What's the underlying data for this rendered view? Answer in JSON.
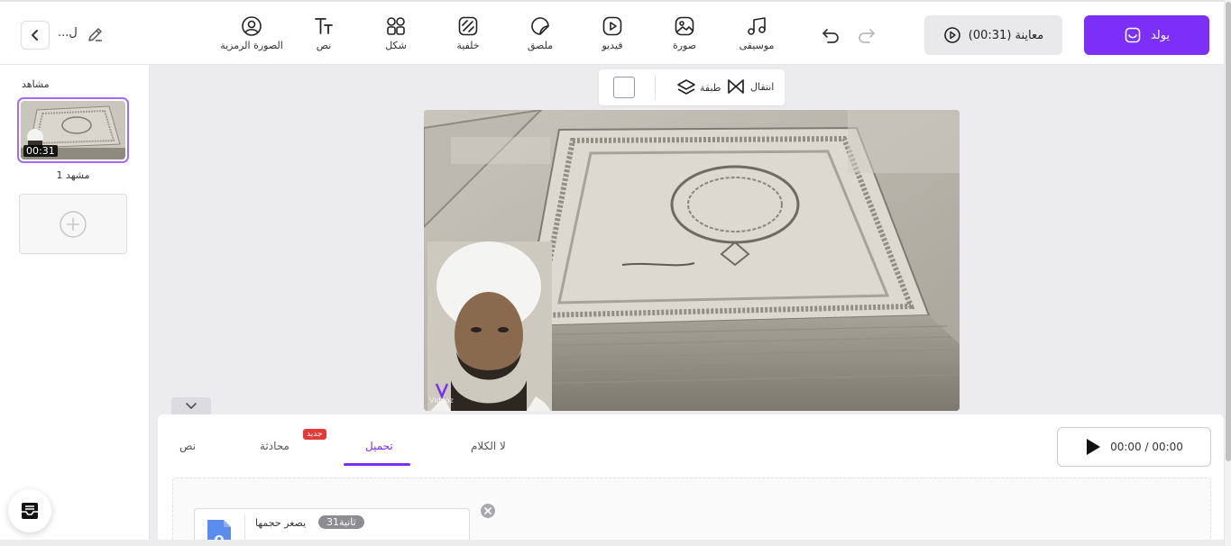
{
  "header": {
    "project_name": "...ل",
    "tools": [
      {
        "label": "موسيقى",
        "icon": "music-note-icon"
      },
      {
        "label": "صورة",
        "icon": "image-icon"
      },
      {
        "label": "فيديو",
        "icon": "video-play-icon"
      },
      {
        "label": "ملصق",
        "icon": "sticker-icon"
      },
      {
        "label": "خلفية",
        "icon": "background-icon"
      },
      {
        "label": "شكل",
        "icon": "shapes-icon"
      },
      {
        "label": "نص",
        "icon": "text-icon"
      },
      {
        "label": "الصورة الرمزية",
        "icon": "avatar-icon"
      }
    ],
    "preview_label": "معاينة (00:31)",
    "generate_label": "يولد"
  },
  "scenes": {
    "title": "مشاهد",
    "items": [
      {
        "label": "مشهد 1",
        "duration": "00:31"
      }
    ]
  },
  "canvas": {
    "layer_label": "طبقة",
    "transition_label": "انتقال",
    "watermark": "Vidnoz"
  },
  "bottom_panel": {
    "tabs": {
      "no_speech": "لا الكلام",
      "upload": "تحميل",
      "conversation": "محادثة",
      "text": "نص"
    },
    "new_badge": "جديد",
    "player_time": "00:00 / 00:00",
    "file": {
      "name": "يصغر حجمها",
      "duration": "ثانية31"
    }
  },
  "colors": {
    "accent": "#7b2ff7",
    "badge": "#e53935"
  }
}
